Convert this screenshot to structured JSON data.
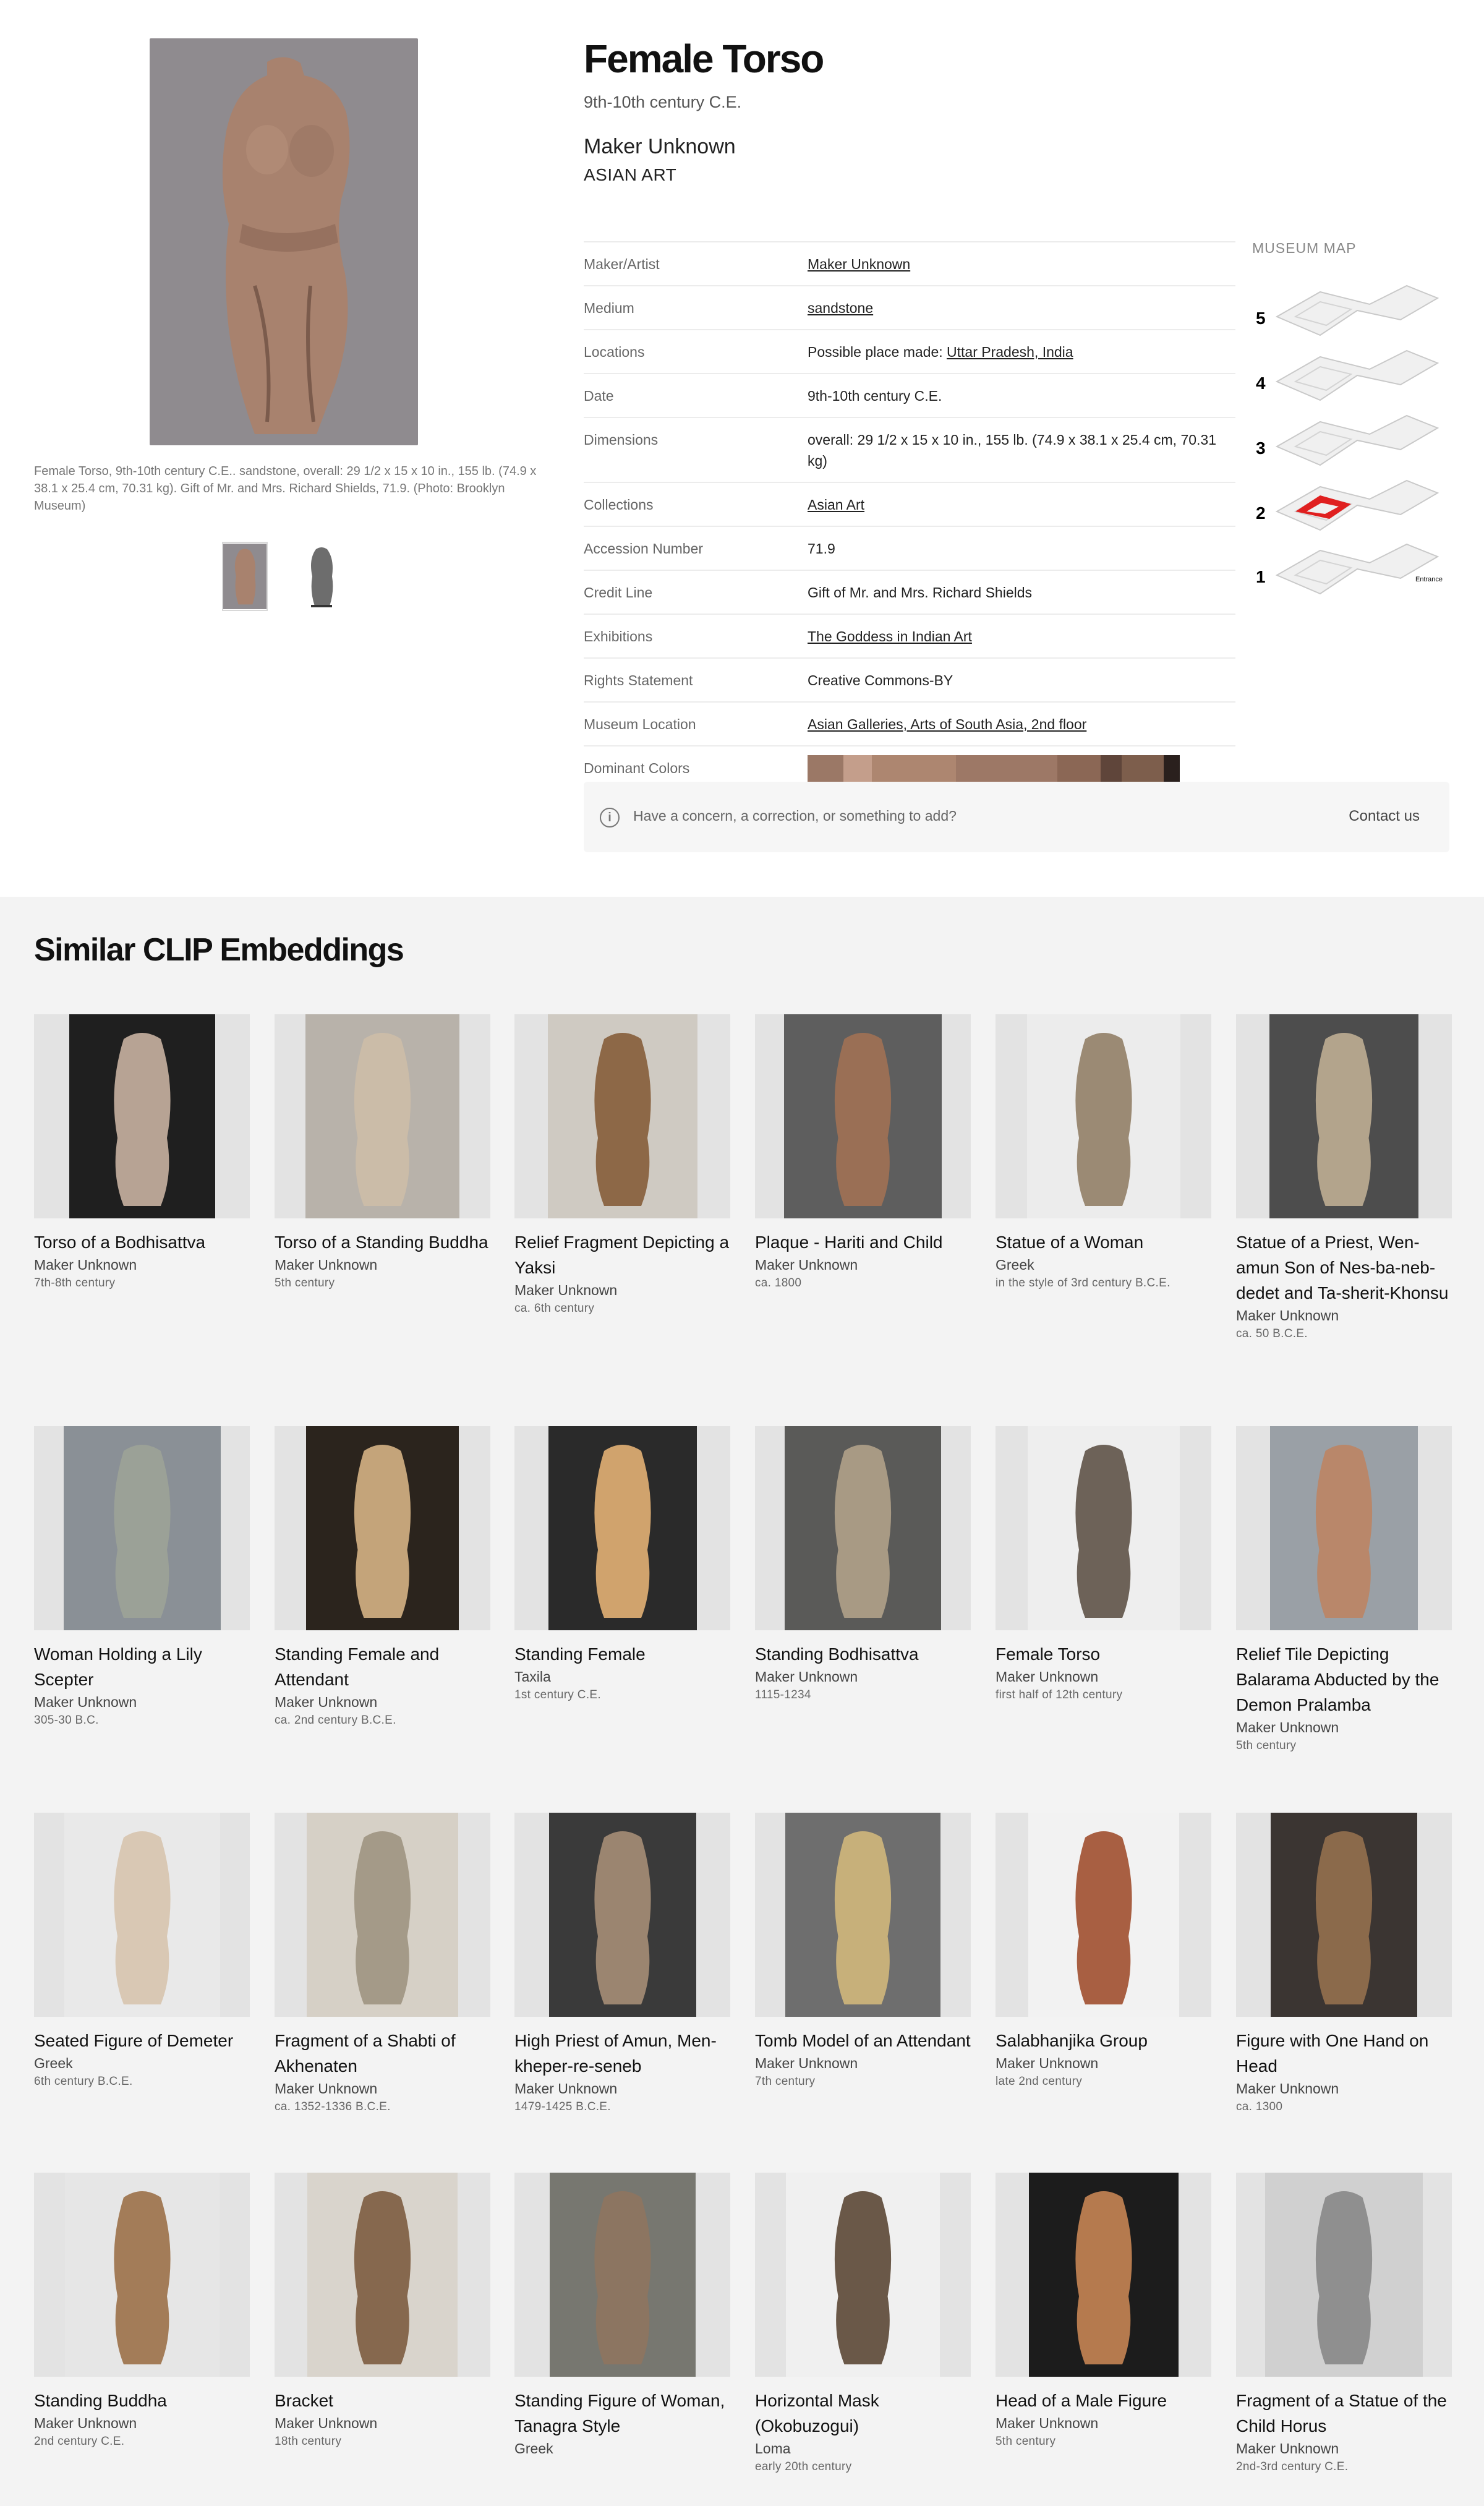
{
  "artwork": {
    "title": "Female Torso",
    "date": "9th-10th century C.E.",
    "maker": "Maker Unknown",
    "department": "ASIAN ART",
    "caption": "Female Torso, 9th-10th century C.E.. sandstone, overall: 29 1/2 x 15 x 10 in., 155 lb. (74.9 x 38.1 x 25.4 cm, 70.31 kg). Gift of Mr. and Mrs. Richard Shields, 71.9. (Photo: Brooklyn Museum)"
  },
  "details": {
    "maker_label": "Maker/Artist",
    "maker_value": "Maker Unknown",
    "medium_label": "Medium",
    "medium_value": "sandstone",
    "locations_label": "Locations",
    "locations_prefix": "Possible place made: ",
    "locations_value": "Uttar Pradesh, India",
    "date_label": "Date",
    "date_value": "9th-10th century C.E.",
    "dimensions_label": "Dimensions",
    "dimensions_value": "overall: 29 1/2 x 15 x 10 in., 155 lb. (74.9 x 38.1 x 25.4 cm, 70.31 kg)",
    "collections_label": "Collections",
    "collections_value": "Asian Art",
    "accession_label": "Accession Number",
    "accession_value": "71.9",
    "credit_label": "Credit Line",
    "credit_value": "Gift of Mr. and Mrs. Richard Shields",
    "exhibitions_label": "Exhibitions",
    "exhibitions_value": "The Goddess in Indian Art",
    "rights_label": "Rights Statement",
    "rights_value": "Creative Commons-BY",
    "location_label": "Museum Location",
    "location_value": "Asian Galleries, Arts of South Asia, 2nd floor",
    "colors_label": "Dominant Colors"
  },
  "dominant_colors": [
    "#9b7866",
    "#c49e8b",
    "#ad8670",
    "#9d7866",
    "#8b6755",
    "#5f453a",
    "#7d5e4c",
    "#2a201d"
  ],
  "map": {
    "label": "MUSEUM MAP",
    "floors": [
      "5",
      "4",
      "3",
      "2",
      "1"
    ],
    "entrance_label": "Entrance",
    "highlight_color": "#e02020"
  },
  "concern": {
    "icon": "info-icon",
    "text": "Have a concern, a correction, or something to add?",
    "link": "Contact us"
  },
  "similar": {
    "title": "Similar CLIP Embeddings",
    "items": [
      {
        "title": "Torso of a Bodhisattva",
        "maker": "Maker Unknown",
        "date": "7th-8th century"
      },
      {
        "title": "Torso of a Standing Buddha",
        "maker": "Maker Unknown",
        "date": "5th century"
      },
      {
        "title": "Relief Fragment Depicting a Yaksi",
        "maker": "Maker Unknown",
        "date": "ca. 6th century"
      },
      {
        "title": "Plaque - Hariti and Child",
        "maker": "Maker Unknown",
        "date": "ca. 1800"
      },
      {
        "title": "Statue of a Woman",
        "maker": "Greek",
        "date": "in the style of 3rd century B.C.E."
      },
      {
        "title": "Statue of a Priest, Wen-amun Son of Nes-ba-neb-dedet and Ta-sherit-Khonsu",
        "maker": "Maker Unknown",
        "date": "ca. 50 B.C.E."
      },
      {
        "title": "Woman Holding a Lily Scepter",
        "maker": "Maker Unknown",
        "date": "305-30 B.C."
      },
      {
        "title": "Standing Female and Attendant",
        "maker": "Maker Unknown",
        "date": "ca. 2nd century B.C.E."
      },
      {
        "title": "Standing Female",
        "maker": "Taxila",
        "date": "1st century C.E."
      },
      {
        "title": "Standing Bodhisattva",
        "maker": "Maker Unknown",
        "date": "1115-1234"
      },
      {
        "title": "Female Torso",
        "maker": "Maker Unknown",
        "date": "first half of 12th century"
      },
      {
        "title": "Relief Tile Depicting Balarama Abducted by the Demon Pralamba",
        "maker": "Maker Unknown",
        "date": "5th century"
      },
      {
        "title": "Seated Figure of Demeter",
        "maker": "Greek",
        "date": "6th century B.C.E."
      },
      {
        "title": "Fragment of a Shabti of Akhenaten",
        "maker": "Maker Unknown",
        "date": "ca. 1352-1336 B.C.E."
      },
      {
        "title": "High Priest of Amun, Men-kheper-re-seneb",
        "maker": "Maker Unknown",
        "date": "1479-1425 B.C.E."
      },
      {
        "title": "Tomb Model of an Attendant",
        "maker": "Maker Unknown",
        "date": "7th century"
      },
      {
        "title": "Salabhanjika Group",
        "maker": "Maker Unknown",
        "date": "late 2nd century"
      },
      {
        "title": "Figure with One Hand on Head",
        "maker": "Maker Unknown",
        "date": "ca. 1300"
      },
      {
        "title": "Standing Buddha",
        "maker": "Maker Unknown",
        "date": "2nd century C.E."
      },
      {
        "title": "Bracket",
        "maker": "Maker Unknown",
        "date": "18th century"
      },
      {
        "title": "Standing Figure of Woman, Tanagra Style",
        "maker": "Greek",
        "date": ""
      },
      {
        "title": "Horizontal Mask (Okobuzogui)",
        "maker": "Loma",
        "date": "early 20th century"
      },
      {
        "title": "Head of a Male Figure",
        "maker": "Maker Unknown",
        "date": "5th century"
      },
      {
        "title": "Fragment of a Statue of the Child Horus",
        "maker": "Maker Unknown",
        "date": "2nd-3rd century C.E."
      }
    ]
  }
}
